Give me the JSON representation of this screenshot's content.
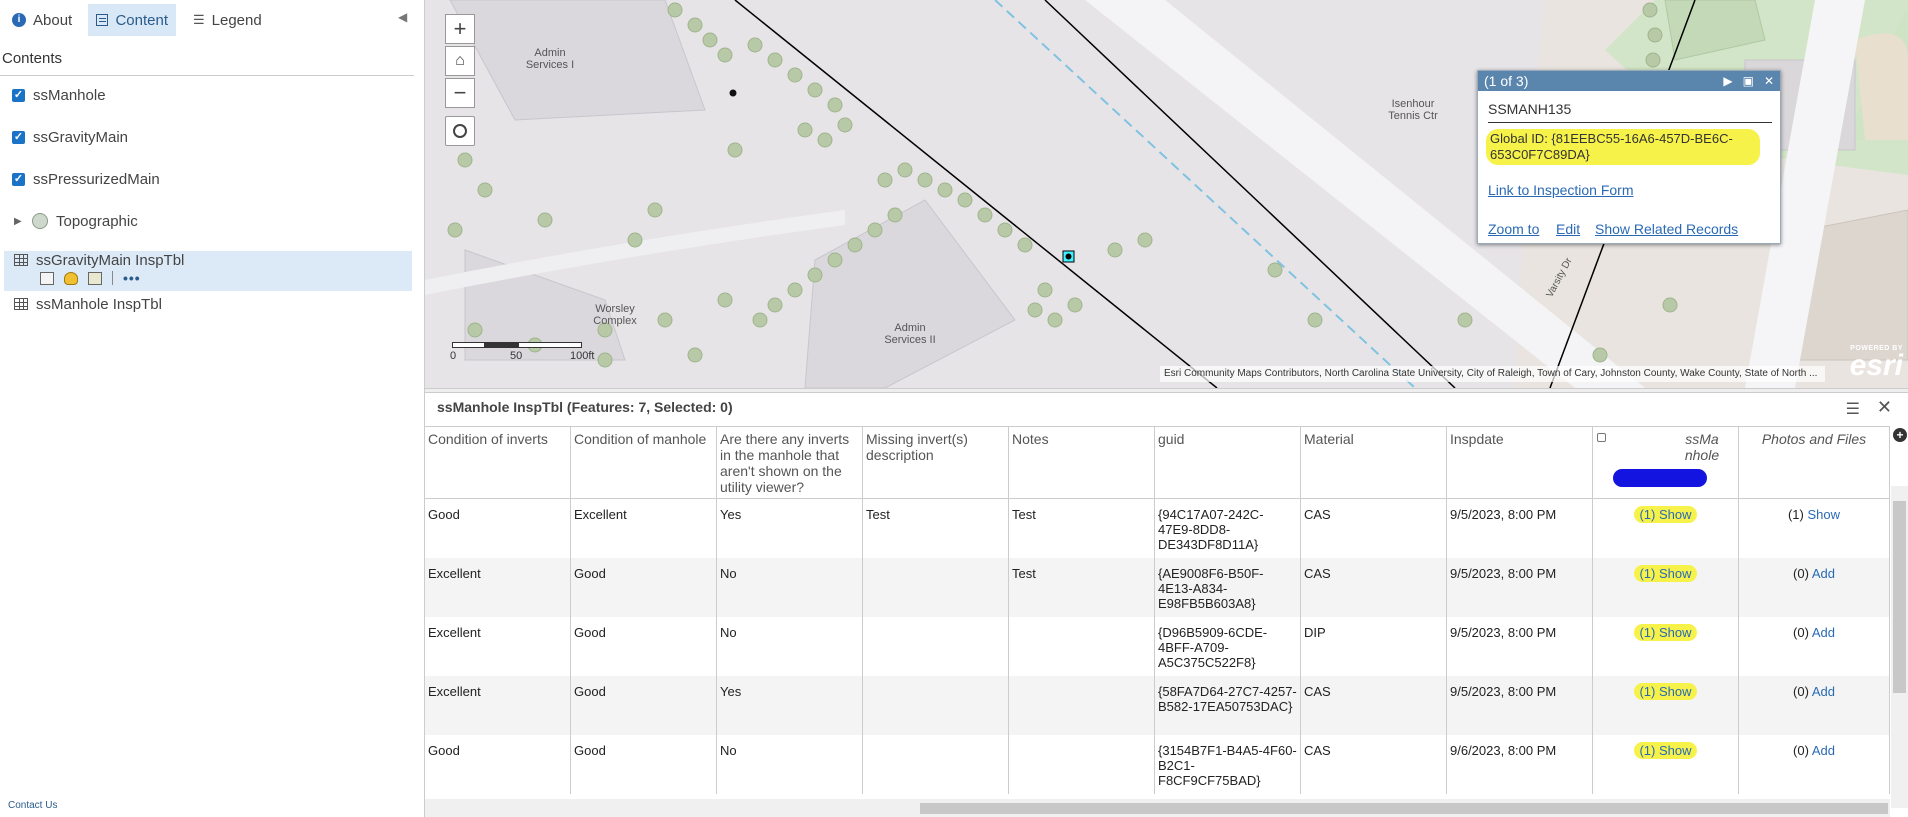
{
  "left": {
    "tabs": [
      {
        "label": "About"
      },
      {
        "label": "Content"
      },
      {
        "label": "Legend"
      }
    ],
    "contents_title": "Contents",
    "layers": [
      {
        "label": "ssManhole"
      },
      {
        "label": "ssGravityMain"
      },
      {
        "label": "ssPressurizedMain"
      },
      {
        "label": "Topographic"
      }
    ],
    "tables": [
      {
        "label": "ssGravityMain InspTbl"
      },
      {
        "label": "ssManhole InspTbl"
      }
    ],
    "contact": "Contact Us"
  },
  "map": {
    "labels": [
      "Admin Services I",
      "Isenhour Tennis Ctr",
      "Worsley Complex",
      "Admin Services II",
      "Varsity Dr"
    ],
    "scalebar": {
      "l0": "0",
      "l1": "50",
      "l2": "100ft"
    },
    "attribution": "Esri Community Maps Contributors, North Carolina State University, City of Raleigh, Town of Cary, Johnston County, Wake County, State of North ...",
    "logo": {
      "powered": "POWERED BY",
      "name": "esri"
    },
    "popup": {
      "counter": "(1 of 3)",
      "title": "SSMANH135",
      "global_id": "Global ID: {81EEBC55-16A6-457D-BE6C-653C0F7C89DA}",
      "link": "Link to Inspection Form",
      "zoom": "Zoom to",
      "edit": "Edit",
      "related": "Show Related Records"
    }
  },
  "table": {
    "title": "ssManhole InspTbl (Features: 7, Selected: 0)",
    "columns": [
      "Condition of inverts",
      "Condition of manhole",
      "Are there any inverts in the manhole that aren't shown on the utility viewer?",
      "Missing invert(s) description",
      "Notes",
      "guid",
      "Material",
      "Inspdate",
      "ssMa nhole",
      "Photos and Files"
    ],
    "rows": [
      {
        "c1": "Good",
        "c2": "Excellent",
        "c3": "Yes",
        "c4": "Test",
        "c5": "Test",
        "guid": "{94C17A07-242C-47E9-8DD8-DE343DF8D11A}",
        "mat": "CAS",
        "date": "9/5/2023, 8:00 PM",
        "rel_count": "(1)",
        "rel_action": "Show",
        "ph_count": "(1)",
        "ph_action": "Show"
      },
      {
        "c1": "Excellent",
        "c2": "Good",
        "c3": "No",
        "c4": "",
        "c5": "Test",
        "guid": "{AE9008F6-B50F-4E13-A834-E98FB5B603A8}",
        "mat": "CAS",
        "date": "9/5/2023, 8:00 PM",
        "rel_count": "(1)",
        "rel_action": "Show",
        "ph_count": "(0)",
        "ph_action": "Add"
      },
      {
        "c1": "Excellent",
        "c2": "Good",
        "c3": "No",
        "c4": "",
        "c5": "",
        "guid": "{D96B5909-6CDE-4BFF-A709-A5C375C522F8}",
        "mat": "DIP",
        "date": "9/5/2023, 8:00 PM",
        "rel_count": "(1)",
        "rel_action": "Show",
        "ph_count": "(0)",
        "ph_action": "Add"
      },
      {
        "c1": "Excellent",
        "c2": "Good",
        "c3": "Yes",
        "c4": "",
        "c5": "",
        "guid": "{58FA7D64-27C7-4257-B582-17EA50753DAC}",
        "mat": "CAS",
        "date": "9/5/2023, 8:00 PM",
        "rel_count": "(1)",
        "rel_action": "Show",
        "ph_count": "(0)",
        "ph_action": "Add"
      },
      {
        "c1": "Good",
        "c2": "Good",
        "c3": "No",
        "c4": "",
        "c5": "",
        "guid": "{3154B7F1-B4A5-4F60-B2C1-F8CF9CF75BAD}",
        "mat": "CAS",
        "date": "9/6/2023, 8:00 PM",
        "rel_count": "(1)",
        "rel_action": "Show",
        "ph_count": "(0)",
        "ph_action": "Add"
      }
    ]
  }
}
